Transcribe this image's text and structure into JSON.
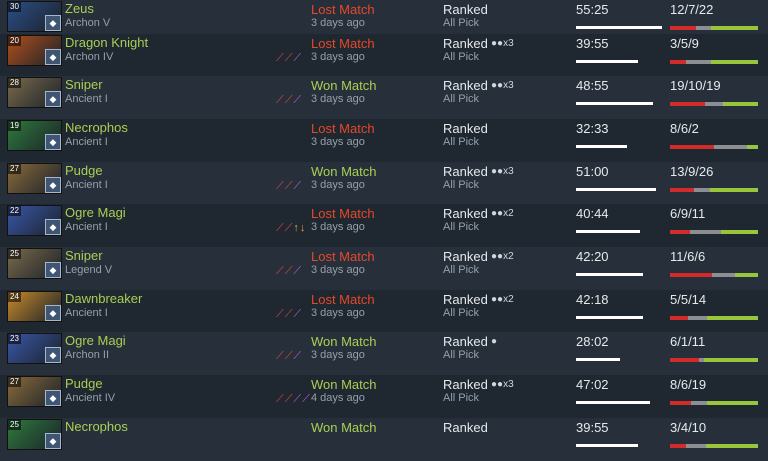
{
  "matches": [
    {
      "hero": "Zeus",
      "level": "30",
      "rank": "Archon V",
      "result": "Lost Match",
      "outcome": "lost",
      "when": "3 days ago",
      "lobby": "Ranked",
      "party": "",
      "mode": "All Pick",
      "duration": "55:25",
      "duration_fraction": 0.98,
      "kda": "12/7/22",
      "k": 12,
      "d": 7,
      "a": 22,
      "items": [
        "",
        ""
      ],
      "role_icon": "lightning-icon",
      "portrait_color": "#2d4e86"
    },
    {
      "hero": "Dragon Knight",
      "level": "20",
      "rank": "Archon IV",
      "result": "Lost Match",
      "outcome": "lost",
      "when": "3 days ago",
      "lobby": "Ranked",
      "party": "x3",
      "mode": "All Pick",
      "duration": "39:55",
      "duration_fraction": 0.71,
      "kda": "3/5/9",
      "k": 3,
      "d": 5,
      "a": 9,
      "items": [
        "⟋⟋",
        "⟋"
      ],
      "role_icon": "knight-icon",
      "portrait_color": "#b14f1a"
    },
    {
      "hero": "Sniper",
      "level": "28",
      "rank": "Ancient I",
      "result": "Won Match",
      "outcome": "won",
      "when": "3 days ago",
      "lobby": "Ranked",
      "party": "x3",
      "mode": "All Pick",
      "duration": "48:55",
      "duration_fraction": 0.87,
      "kda": "19/10/19",
      "k": 19,
      "d": 10,
      "a": 19,
      "items": [
        "⟋⟋",
        "⟋"
      ],
      "role_icon": "eye-icon",
      "portrait_color": "#7a6a4a"
    },
    {
      "hero": "Necrophos",
      "level": "19",
      "rank": "Ancient I",
      "result": "Lost Match",
      "outcome": "lost",
      "when": "3 days ago",
      "lobby": "Ranked",
      "party": "",
      "mode": "All Pick",
      "duration": "32:33",
      "duration_fraction": 0.58,
      "kda": "8/6/2",
      "k": 8,
      "d": 6,
      "a": 2,
      "items": [
        "",
        ""
      ],
      "role_icon": "skull-icon",
      "portrait_color": "#2f7a3c"
    },
    {
      "hero": "Pudge",
      "level": "27",
      "rank": "Ancient I",
      "result": "Won Match",
      "outcome": "won",
      "when": "3 days ago",
      "lobby": "Ranked",
      "party": "x3",
      "mode": "All Pick",
      "duration": "51:00",
      "duration_fraction": 0.91,
      "kda": "13/9/26",
      "k": 13,
      "d": 9,
      "a": 26,
      "items": [
        "⟋⟋",
        "⟋"
      ],
      "role_icon": "hook-icon",
      "portrait_color": "#8a6a3a"
    },
    {
      "hero": "Ogre Magi",
      "level": "22",
      "rank": "Ancient I",
      "result": "Lost Match",
      "outcome": "lost",
      "when": "3 days ago",
      "lobby": "Ranked",
      "party": "x2",
      "mode": "All Pick",
      "duration": "40:44",
      "duration_fraction": 0.73,
      "kda": "6/9/11",
      "k": 6,
      "d": 9,
      "a": 11,
      "items": [
        "⟋⟋",
        "↑↓"
      ],
      "role_icon": "shield-icon",
      "portrait_color": "#3a57a8"
    },
    {
      "hero": "Sniper",
      "level": "25",
      "rank": "Legend V",
      "result": "Lost Match",
      "outcome": "lost",
      "when": "3 days ago",
      "lobby": "Ranked",
      "party": "x2",
      "mode": "All Pick",
      "duration": "42:20",
      "duration_fraction": 0.76,
      "kda": "11/6/6",
      "k": 11,
      "d": 6,
      "a": 6,
      "items": [
        "⟋⟋",
        "⟋"
      ],
      "role_icon": "eye-icon",
      "portrait_color": "#7a6a4a"
    },
    {
      "hero": "Dawnbreaker",
      "level": "24",
      "rank": "Ancient I",
      "result": "Lost Match",
      "outcome": "lost",
      "when": "3 days ago",
      "lobby": "Ranked",
      "party": "x2",
      "mode": "All Pick",
      "duration": "42:18",
      "duration_fraction": 0.76,
      "kda": "5/5/14",
      "k": 5,
      "d": 5,
      "a": 14,
      "items": [
        "⟋⟋",
        "⟋"
      ],
      "role_icon": "hourglass-icon",
      "portrait_color": "#c98a2a"
    },
    {
      "hero": "Ogre Magi",
      "level": "23",
      "rank": "Archon II",
      "result": "Won Match",
      "outcome": "won",
      "when": "3 days ago",
      "lobby": "Ranked",
      "party": "solo",
      "mode": "All Pick",
      "duration": "28:02",
      "duration_fraction": 0.5,
      "kda": "6/1/11",
      "k": 6,
      "d": 1,
      "a": 11,
      "items": [
        "⟋⟋",
        "⟋"
      ],
      "role_icon": "shield-icon",
      "portrait_color": "#3a57a8"
    },
    {
      "hero": "Pudge",
      "level": "27",
      "rank": "Ancient IV",
      "result": "Won Match",
      "outcome": "won",
      "when": "4 days ago",
      "lobby": "Ranked",
      "party": "x3",
      "mode": "All Pick",
      "duration": "47:02",
      "duration_fraction": 0.84,
      "kda": "8/6/19",
      "k": 8,
      "d": 6,
      "a": 19,
      "items": [
        "⟋⟋",
        "⟋⟋"
      ],
      "role_icon": "hook-icon",
      "portrait_color": "#8a6a3a"
    },
    {
      "hero": "Necrophos",
      "level": "25",
      "rank": "",
      "result": "Won Match",
      "outcome": "won",
      "when": "",
      "lobby": "Ranked",
      "party": "",
      "mode": "",
      "duration": "39:55",
      "duration_fraction": 0.71,
      "kda": "3/4/10",
      "k": 3,
      "d": 4,
      "a": 10,
      "items": [
        "",
        ""
      ],
      "role_icon": "skull-icon",
      "portrait_color": "#2f7a3c"
    }
  ]
}
